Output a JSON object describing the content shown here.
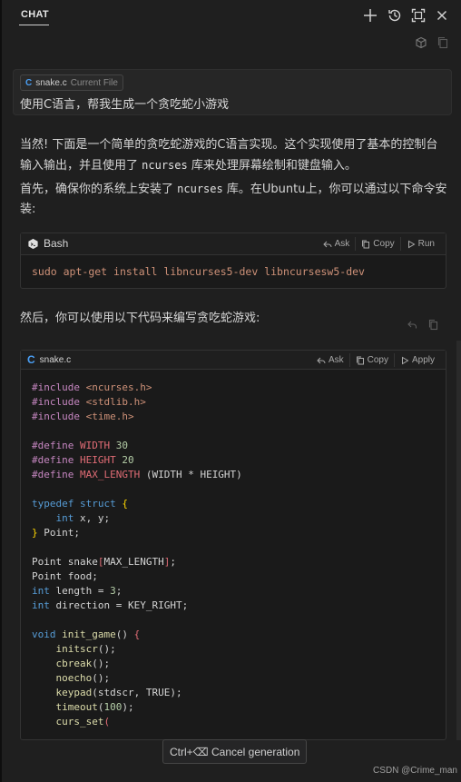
{
  "header": {
    "title": "CHAT",
    "icons": [
      "plus-icon",
      "history-icon",
      "maximize-icon",
      "close-icon"
    ]
  },
  "sub_toolbar": {
    "icons": [
      "cube-icon",
      "copy-icon"
    ]
  },
  "input": {
    "chip_letter": "C",
    "file_name": "snake.c",
    "file_tag": "Current File",
    "prompt": "使用C语言，帮我生成一个贪吃蛇小游戏"
  },
  "response": {
    "intro_1": "当然! 下面是一个简单的贪吃蛇游戏的C语言实现。这个实现使用了基本的控制台输入输出，并且使用了",
    "intro_code": "ncurses",
    "intro_2": "库来处理屏幕绘制和键盘输入。",
    "install_1": "首先，确保你的系统上安装了",
    "install_code": "ncurses",
    "install_2": "库。在Ubuntu上，你可以通过以下命令安装:",
    "bash_block": {
      "lang": "Bash",
      "actions": [
        "Ask",
        "Copy",
        "Run"
      ],
      "command_parts": [
        "sudo",
        " apt-get install libncurses5-dev libncursesw5-dev"
      ]
    },
    "then_text": "然后，你可以使用以下代码来编写贪吃蛇游戏:",
    "c_block": {
      "lang_letter": "C",
      "lang": "snake.c",
      "actions": [
        "Ask",
        "Copy",
        "Apply"
      ]
    }
  },
  "tooltip": "Ctrl+⌫ Cancel generation",
  "watermark": "CSDN @Crime_man"
}
